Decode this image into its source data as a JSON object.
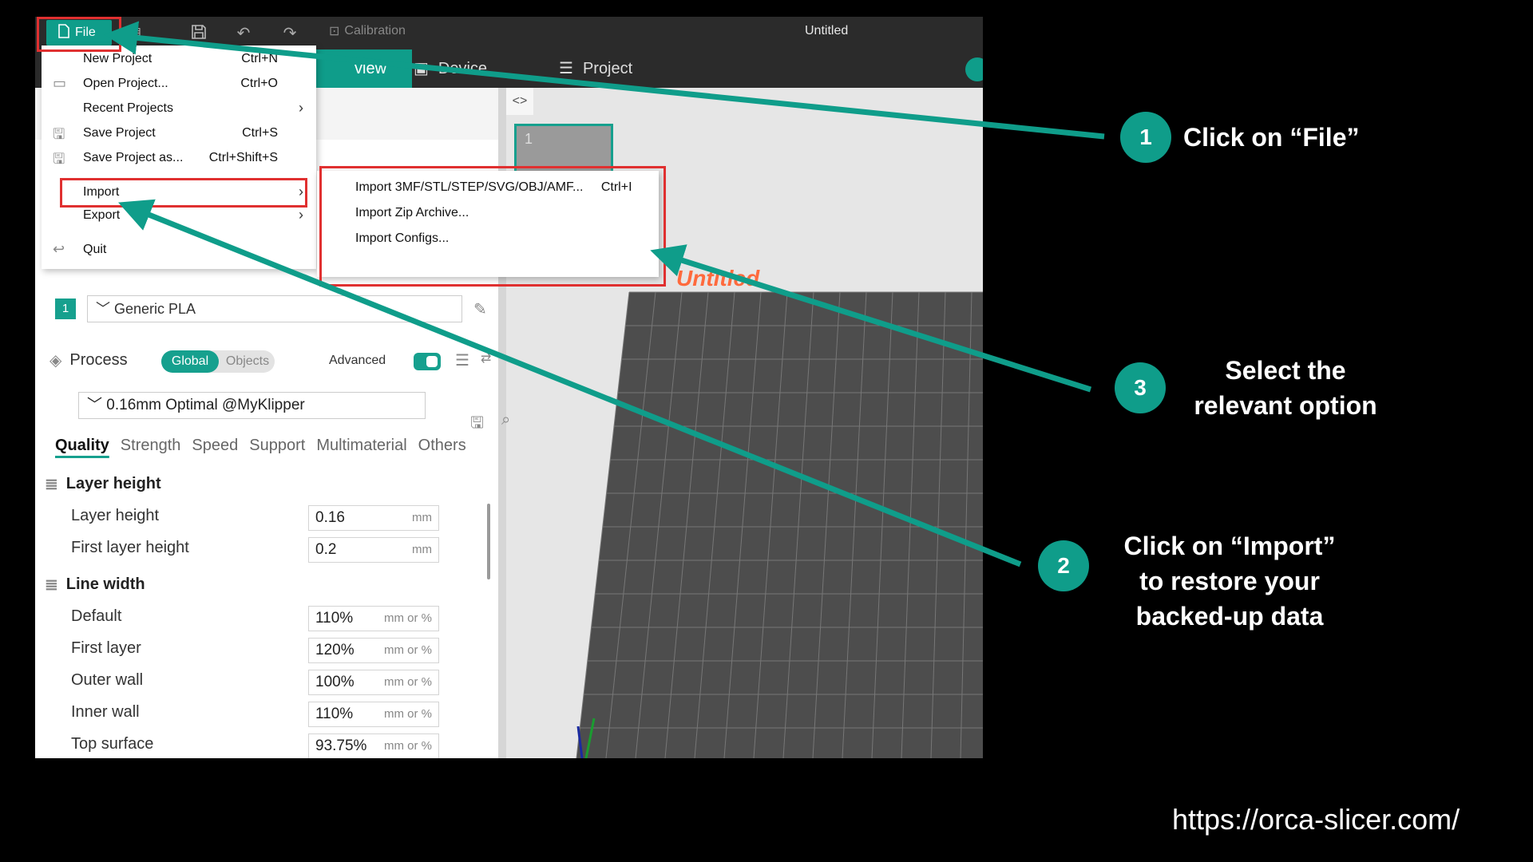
{
  "app": {
    "file_label": "File",
    "calibration_label": "Calibration",
    "window_title": "Untitled",
    "tabs": [
      {
        "label": "view"
      },
      {
        "label": "Device"
      },
      {
        "label": "Project"
      }
    ]
  },
  "file_menu": {
    "items": [
      {
        "label": "New Project",
        "shortcut": "Ctrl+N"
      },
      {
        "label": "Open Project...",
        "shortcut": "Ctrl+O"
      },
      {
        "label": "Recent Projects",
        "shortcut": ""
      },
      {
        "label": "Save Project",
        "shortcut": "Ctrl+S"
      },
      {
        "label": "Save Project as...",
        "shortcut": "Ctrl+Shift+S"
      },
      {
        "label": "Import",
        "shortcut": ""
      },
      {
        "label": "Export",
        "shortcut": ""
      },
      {
        "label": "Quit",
        "shortcut": ""
      }
    ]
  },
  "import_submenu": {
    "items": [
      {
        "label": "Import 3MF/STL/STEP/SVG/OBJ/AMF...",
        "shortcut": "Ctrl+I"
      },
      {
        "label": "Import Zip Archive...",
        "shortcut": ""
      },
      {
        "label": "Import Configs...",
        "shortcut": ""
      }
    ]
  },
  "viewport": {
    "plate_number": "1",
    "plate_name": "Untitled"
  },
  "filament": {
    "index": "1",
    "name": "Generic PLA"
  },
  "process": {
    "title": "Process",
    "global_label": "Global",
    "objects_label": "Objects",
    "advanced_label": "Advanced",
    "preset": "0.16mm Optimal @MyKlipper",
    "tabs": [
      "Quality",
      "Strength",
      "Speed",
      "Support",
      "Multimaterial",
      "Others"
    ]
  },
  "settings": {
    "layer_height_section": "Layer height",
    "layer_height": {
      "label": "Layer height",
      "value": "0.16",
      "unit": "mm"
    },
    "first_layer_height": {
      "label": "First layer height",
      "value": "0.2",
      "unit": "mm"
    },
    "line_width_section": "Line width",
    "line_widths": [
      {
        "label": "Default",
        "value": "110%",
        "unit": "mm or %"
      },
      {
        "label": "First layer",
        "value": "120%",
        "unit": "mm or %"
      },
      {
        "label": "Outer wall",
        "value": "100%",
        "unit": "mm or %"
      },
      {
        "label": "Inner wall",
        "value": "110%",
        "unit": "mm or %"
      },
      {
        "label": "Top surface",
        "value": "93.75%",
        "unit": "mm or %"
      }
    ]
  },
  "annotations": [
    {
      "number": "1",
      "text_line1": "Click on “File”"
    },
    {
      "number": "2",
      "text_line1": "Click on “Import”",
      "text_line2": "to restore your",
      "text_line3": "backed-up data"
    },
    {
      "number": "3",
      "text_line1": "Select the",
      "text_line2": "relevant option"
    }
  ],
  "url": "https://orca-slicer.com/",
  "colors": {
    "accent": "#0f9d8a",
    "highlight": "#e03030",
    "background": "#000000"
  }
}
